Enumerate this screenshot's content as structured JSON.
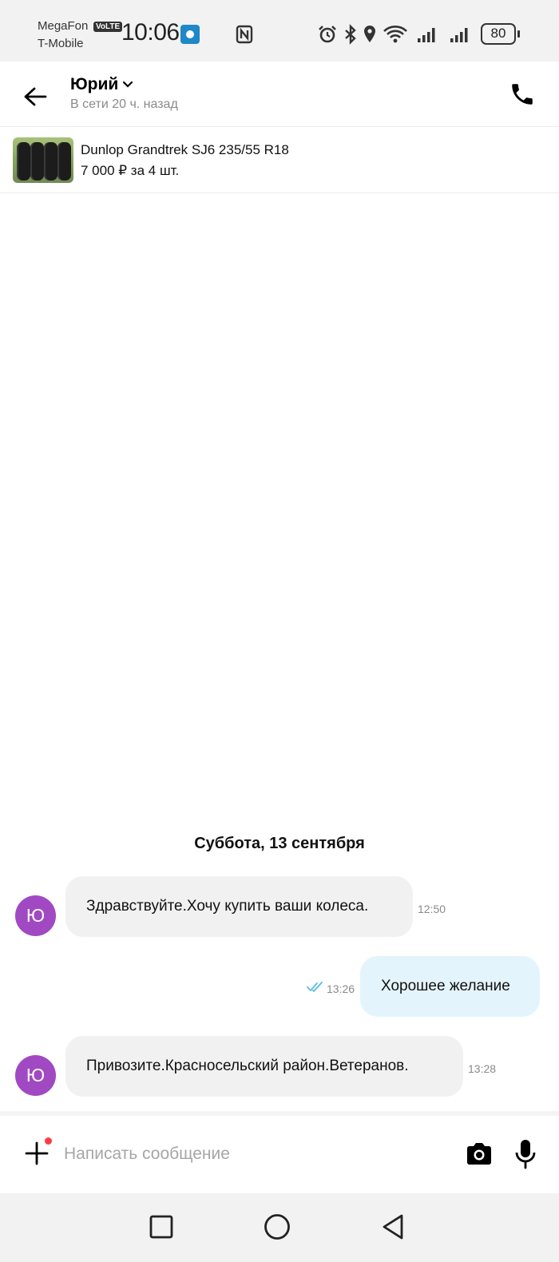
{
  "status_bar": {
    "carrier1": "MegaFon",
    "volte": "VoLTE",
    "carrier2": "T-Mobile",
    "time": "10:06",
    "battery": "80"
  },
  "header": {
    "contact_name": "Юрий",
    "contact_status": "В сети 20 ч. назад"
  },
  "listing": {
    "title": "Dunlop Grandtrek SJ6 235/55 R18",
    "price": "7 000 ₽ за 4 шт."
  },
  "chat": {
    "date_separator": "Суббота, 13 сентября",
    "messages": [
      {
        "direction": "in",
        "avatar": "Ю",
        "text": "Здравствуйте.Хочу купить ваши колеса.",
        "time": "12:50"
      },
      {
        "direction": "out",
        "text": "Хорошее желание",
        "time": "13:26",
        "status": "read"
      },
      {
        "direction": "in",
        "avatar": "Ю",
        "text": "Привозите.Красносельский район.Ветеранов.",
        "time": "13:28"
      }
    ]
  },
  "composer": {
    "placeholder": "Написать сообщение",
    "value": ""
  },
  "colors": {
    "avatar": "#a149c2",
    "outgoing_bubble": "#e4f4fc",
    "incoming_bubble": "#f1f1f1",
    "read_ticks": "#5bbbe6",
    "notification_dot": "#ff3b48"
  },
  "icons": {
    "back": "arrow-left-icon",
    "call": "phone-icon",
    "add": "plus-icon",
    "camera": "camera-icon",
    "mic": "microphone-icon"
  }
}
